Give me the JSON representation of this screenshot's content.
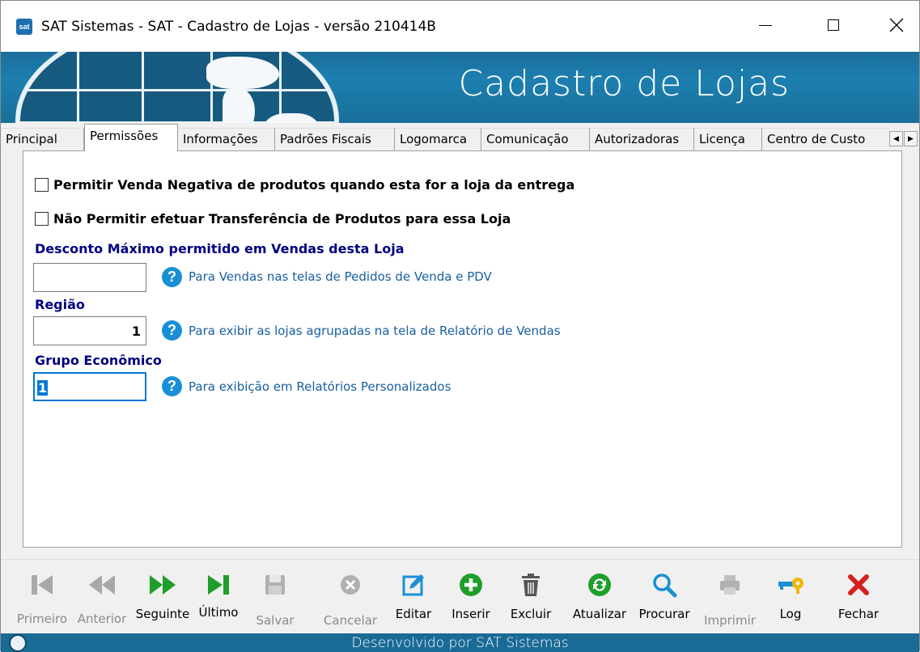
{
  "window": {
    "title": "SAT Sistemas - SAT - Cadastro de Lojas - versão 210414B",
    "app_icon_text": "sat"
  },
  "banner": {
    "title": "Cadastro de Lojas"
  },
  "tabs": [
    {
      "label": "Principal"
    },
    {
      "label": "Permissões",
      "active": true
    },
    {
      "label": "Informações"
    },
    {
      "label": "Padrões Fiscais"
    },
    {
      "label": "Logomarca"
    },
    {
      "label": "Comunicação"
    },
    {
      "label": "Autorizadoras"
    },
    {
      "label": "Licença"
    },
    {
      "label": "Centro de Custo"
    }
  ],
  "permissions": {
    "checkbox_negative_sale": {
      "label": "Permitir Venda Negativa de produtos quando esta for a loja da entrega",
      "checked": false
    },
    "checkbox_no_transfer": {
      "label": "Não Permitir efetuar Transferência de Produtos para essa Loja",
      "checked": false
    },
    "discount": {
      "label": "Desconto Máximo permitido em Vendas desta Loja",
      "value": "",
      "help": "Para Vendas nas telas de Pedidos de Venda e PDV"
    },
    "region": {
      "label": "Região",
      "value": "1",
      "help": "Para exibir as lojas agrupadas na tela de Relatório de Vendas"
    },
    "economic_group": {
      "label": "Grupo Econômico",
      "value": "1",
      "help": "Para exibição em Relatórios Personalizados"
    }
  },
  "toolbar": {
    "first": "Primeiro",
    "previous": "Anterior",
    "next": "Seguinte",
    "last": "Último",
    "save": "Salvar",
    "cancel": "Cancelar",
    "edit": "Editar",
    "insert": "Inserir",
    "delete": "Excluir",
    "refresh": "Atualizar",
    "search": "Procurar",
    "print": "Imprimir",
    "log": "Log",
    "close": "Fechar"
  },
  "footer": {
    "text": "Desenvolvido por SAT Sistemas"
  },
  "colors": {
    "banner": "#1c7fb0",
    "label_blue": "#000080",
    "help_text": "#1a5fa0",
    "icon_green": "#1e9e2a",
    "icon_blue": "#1a8fd6",
    "icon_red": "#d62020",
    "disabled_gray": "#a8a8a8"
  }
}
